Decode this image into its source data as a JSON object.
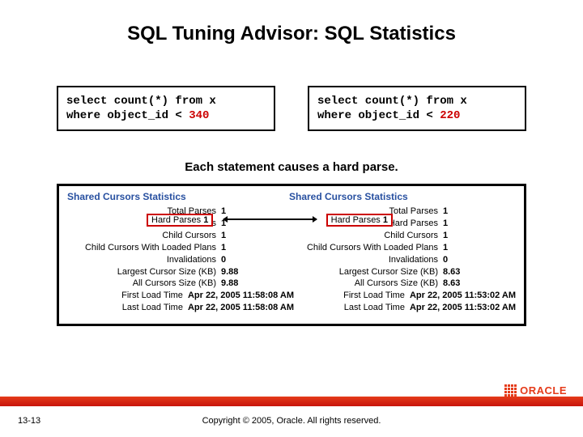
{
  "title": "SQL Tuning Advisor: SQL Statistics",
  "sql": {
    "left": {
      "line1": "select count(*) from x",
      "line2a": "where object_id < ",
      "line2b": "340"
    },
    "right": {
      "line1": "select count(*) from x",
      "line2a": "where object_id < ",
      "line2b": "220"
    }
  },
  "caption": "Each statement causes a hard parse.",
  "stats": {
    "left": {
      "heading": "Shared Cursors Statistics",
      "rows": [
        {
          "label": "Total Parses",
          "value": "1"
        },
        {
          "label": "Hard Parses",
          "value": "1"
        },
        {
          "label": "Child Cursors",
          "value": "1"
        },
        {
          "label": "Child Cursors With Loaded Plans",
          "value": "1"
        },
        {
          "label": "Invalidations",
          "value": "0"
        },
        {
          "label": "Largest Cursor Size (KB)",
          "value": "9.88"
        },
        {
          "label": "All Cursors Size (KB)",
          "value": "9.88"
        },
        {
          "label": "First Load Time",
          "value": "Apr 22, 2005 11:58:08 AM"
        },
        {
          "label": "Last Load Time",
          "value": "Apr 22, 2005 11:58:08 AM"
        }
      ]
    },
    "right": {
      "heading": "Shared Cursors Statistics",
      "rows": [
        {
          "label": "Total Parses",
          "value": "1"
        },
        {
          "label": "Hard Parses",
          "value": "1"
        },
        {
          "label": "Child Cursors",
          "value": "1"
        },
        {
          "label": "Child Cursors With Loaded Plans",
          "value": "1"
        },
        {
          "label": "Invalidations",
          "value": "0"
        },
        {
          "label": "Largest Cursor Size (KB)",
          "value": "8.63"
        },
        {
          "label": "All Cursors Size (KB)",
          "value": "8.63"
        },
        {
          "label": "First Load Time",
          "value": "Apr 22, 2005 11:53:02 AM"
        },
        {
          "label": "Last Load Time",
          "value": "Apr 22, 2005 11:53:02 AM"
        }
      ]
    }
  },
  "footer": {
    "page": "13-13",
    "copyright": "Copyright © 2005, Oracle. All rights reserved.",
    "brand": "ORACLE"
  }
}
